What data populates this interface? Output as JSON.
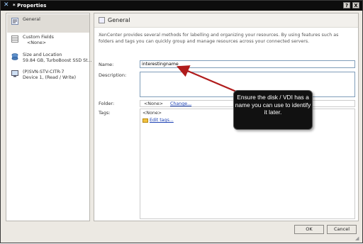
{
  "window": {
    "title": "* Properties",
    "help_label": "?",
    "close_label": "X"
  },
  "sidebar": {
    "items": [
      {
        "label": "General",
        "sub": "",
        "icon": "general-icon"
      },
      {
        "label": "Custom Fields",
        "sub": "<None>",
        "icon": "custom-fields-icon"
      },
      {
        "label": "Size and Location",
        "sub": "59.84 GB, TurboBoost SSD St...",
        "icon": "disk-icon"
      },
      {
        "label": "(P)SVN-STV-CITR-7",
        "sub": "Device 1, (Read / Write)",
        "icon": "vm-icon"
      }
    ]
  },
  "content": {
    "title": "General",
    "description": "XenCenter provides several methods for labelling and organizing your resources. By using features such as folders and tags you can quickly group and manage resources across your connected servers.",
    "name_label": "Name:",
    "name_value": "interestingname",
    "description_label": "Description:",
    "folder_label": "Folder:",
    "folder_value": "<None>",
    "change_link": "Change...",
    "tags_label": "Tags:",
    "tags_value": "<None>",
    "edit_tags_link": "Edit tags..."
  },
  "callout": {
    "text": "Ensure the disk / VDI has a name you can use to identify it later."
  },
  "footer": {
    "ok_label": "OK",
    "cancel_label": "Cancel"
  },
  "colors": {
    "titlebar": "#0d0d0d",
    "callout_bg": "#111111",
    "arrow": "#b01c1c",
    "link": "#1a3fb3"
  }
}
